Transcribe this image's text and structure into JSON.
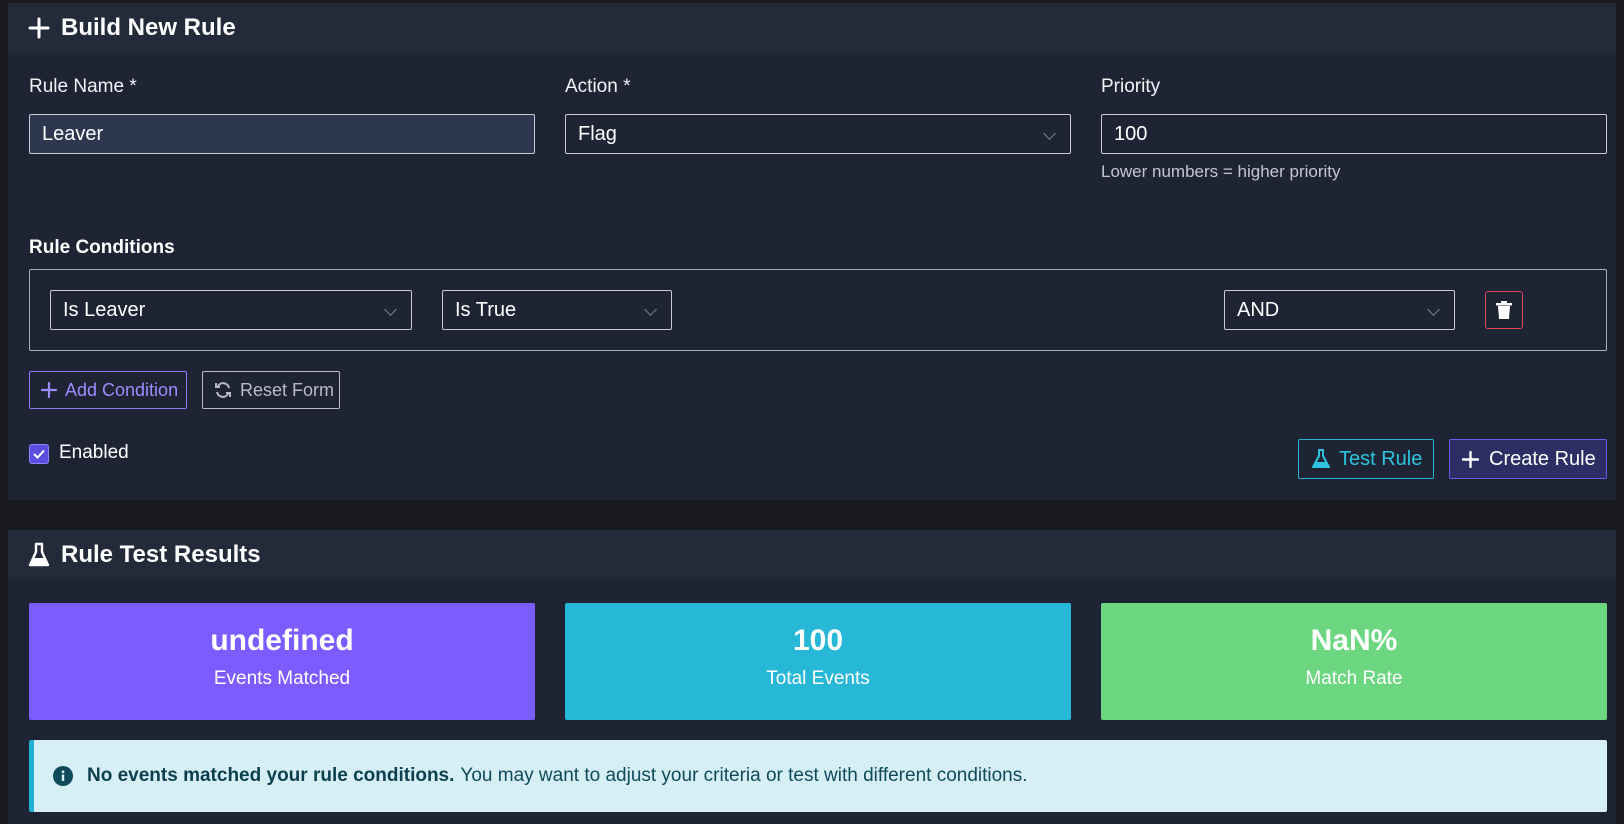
{
  "build_card": {
    "title": "Build New Rule",
    "rule_name": {
      "label": "Rule Name *",
      "value": "Leaver"
    },
    "action": {
      "label": "Action *",
      "value": "Flag"
    },
    "priority": {
      "label": "Priority",
      "value": "100",
      "hint": "Lower numbers = higher priority"
    },
    "conditions": {
      "title": "Rule Conditions",
      "rows": [
        {
          "field": "Is Leaver",
          "operator": "Is True",
          "logic": "AND"
        }
      ]
    },
    "add_condition_label": "Add Condition",
    "reset_form_label": "Reset Form",
    "enabled_label": "Enabled",
    "enabled": true,
    "test_rule_label": "Test Rule",
    "create_rule_label": "Create Rule"
  },
  "results_card": {
    "title": "Rule Test Results",
    "stats": [
      {
        "value": "undefined",
        "label": "Events Matched",
        "color": "#7b5cff"
      },
      {
        "value": "100",
        "label": "Total Events",
        "color": "#26b8d6"
      },
      {
        "value": "NaN%",
        "label": "Match Rate",
        "color": "#6dd680"
      }
    ],
    "alert": {
      "strong": "No events matched your rule conditions.",
      "text": "You may want to adjust your criteria or test with different conditions."
    }
  }
}
